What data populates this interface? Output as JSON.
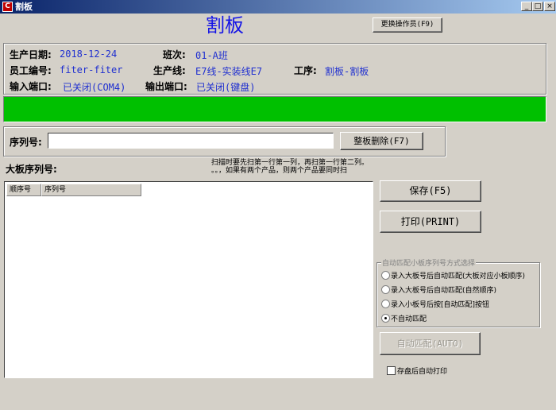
{
  "window": {
    "title": "割板",
    "app_icon": "app-logo-icon",
    "controls": {
      "minimize": "_",
      "maximize": "□",
      "close": "×"
    }
  },
  "header": {
    "title": "割板",
    "change_operator_label": "更换操作员(F9)"
  },
  "info": {
    "production_date_label": "生产日期:",
    "production_date": "2018-12-24",
    "shift_label": "班次:",
    "shift": "01-A班",
    "employee_id_label": "员工编号:",
    "employee_id": "fiter-fiter",
    "production_line_label": "生产线:",
    "production_line": "E7线-实装线E7",
    "process_label": "工序:",
    "process": "割板-割板",
    "input_port_label": "输入端口:",
    "input_port": "已关闭(COM4)",
    "output_port_label": "输出端口:",
    "output_port": "已关闭(键盘)"
  },
  "status": {
    "color": "#00c000"
  },
  "serial": {
    "label": "序列号:",
    "value": "",
    "delete_board_label": "整板删除(F7)"
  },
  "big_board": {
    "label": "大板序列号:",
    "hint_line1": "扫描时要先扫第一行第一列，再扫第一行第二列。",
    "hint_line2": "。。，如果有两个产品，则两个产品要同时扫",
    "columns": [
      "顺序号",
      "序列号"
    ],
    "rows": []
  },
  "actions": {
    "save_label": "保存(F5)",
    "print_label": "打印(PRINT)",
    "auto_match_label": "自动匹配(AUTO)"
  },
  "match_mode": {
    "group_label": "自动匹配小板序列号方式选择",
    "options": [
      {
        "label": "录入大板号后自动匹配(大板对应小板顺序)",
        "selected": false
      },
      {
        "label": "录入大板号后自动匹配(自然顺序)",
        "selected": false
      },
      {
        "label": "录入小板号后按[自动匹配]按钮",
        "selected": false
      },
      {
        "label": "不自动匹配",
        "selected": true
      }
    ]
  },
  "auto_print": {
    "label": "存盘后自动打印",
    "checked": false
  }
}
